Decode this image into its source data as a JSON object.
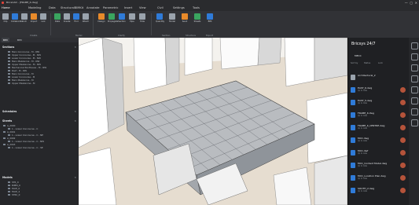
{
  "app": {
    "title": "BricsCAD - [FRAME_K.dwg]"
  },
  "menu": {
    "tabs": [
      "Home",
      "Modeling",
      "Data",
      "StructuralBIMKit",
      "Annotate",
      "Parametric",
      "Insert",
      "View",
      "Civil",
      "Settings",
      "Tools"
    ]
  },
  "ribbon": {
    "buttons": [
      "Clip",
      "Collaborate",
      "Unit",
      "Import",
      "Link",
      "Data",
      "Create",
      "Find",
      "Attach",
      "Design",
      "Propagate",
      "Section",
      "Pipe",
      "Hide",
      "Quantity",
      "Model",
      "Send",
      "Sheets",
      "BIM"
    ],
    "groups": [
      "Create",
      "Model",
      "Clarify",
      "Section",
      "Structure",
      "Export"
    ],
    "colors": {
      "blue": "#2f7bd8",
      "orange": "#e88a2a",
      "green": "#3aa55f",
      "gray": "#9aa3ad"
    }
  },
  "left_panel": {
    "tabs": [
      "BIM",
      "BIM"
    ],
    "sections_title": "Sections",
    "sections": [
      "Main Concourse - M - NW",
      "Upper Concourse - M - NW",
      "Lower Concourse - M - NW",
      "Main Mezzanine - M - NW",
      "Upper Mezzanine - M - NW",
      "Mechanical Penthouse - M - NW",
      "Roof - M - NW",
      "Main Concourse - M",
      "Lower Concourse - M",
      "Main Mezzanine - M",
      "Upper Mezzanine - M"
    ],
    "schedules_title": "Schedules",
    "sheets_title": "Sheets",
    "sheets": [
      "A_2000",
      "1 - Lower Concourse - C",
      "A_2001",
      "1 - Lower Concourse - C - NE",
      "A_2002",
      "1 - Lower Concourse - C - NW",
      "A_2003",
      "1 - Lower Concourse - C - SE"
    ],
    "models_title": "Models",
    "models": [
      "STR_0",
      "BIMM_0",
      "FACE_0",
      "FACE_4",
      "STRC_0"
    ]
  },
  "right_panel": {
    "title": "Bricsys 24/7",
    "folder": "MECC",
    "columns": [
      "Sort by",
      "Status",
      "Lock"
    ],
    "files": [
      {
        "name": "Architectural_2",
        "sub": ""
      },
      {
        "name": "EAST_6.dwg",
        "sub": "Up to date"
      },
      {
        "name": "EAST_5.dwg",
        "sub": "Up to date"
      },
      {
        "name": "FRAME_K.dwg",
        "sub": "Up to date"
      },
      {
        "name": "FRAME_K_CENTRE.dwg",
        "sub": "Up to date"
      },
      {
        "name": "MCC.dwg",
        "sub": "Up to date"
      },
      {
        "name": "MCC.dwf",
        "sub": "Up to date"
      },
      {
        "name": "MCC_Context Model.dwg",
        "sub": "Up to date"
      },
      {
        "name": "MCC_Location Plan.dwg",
        "sub": "Up to date"
      },
      {
        "name": "SOUTH_2.dwg",
        "sub": "Up to date"
      }
    ]
  }
}
